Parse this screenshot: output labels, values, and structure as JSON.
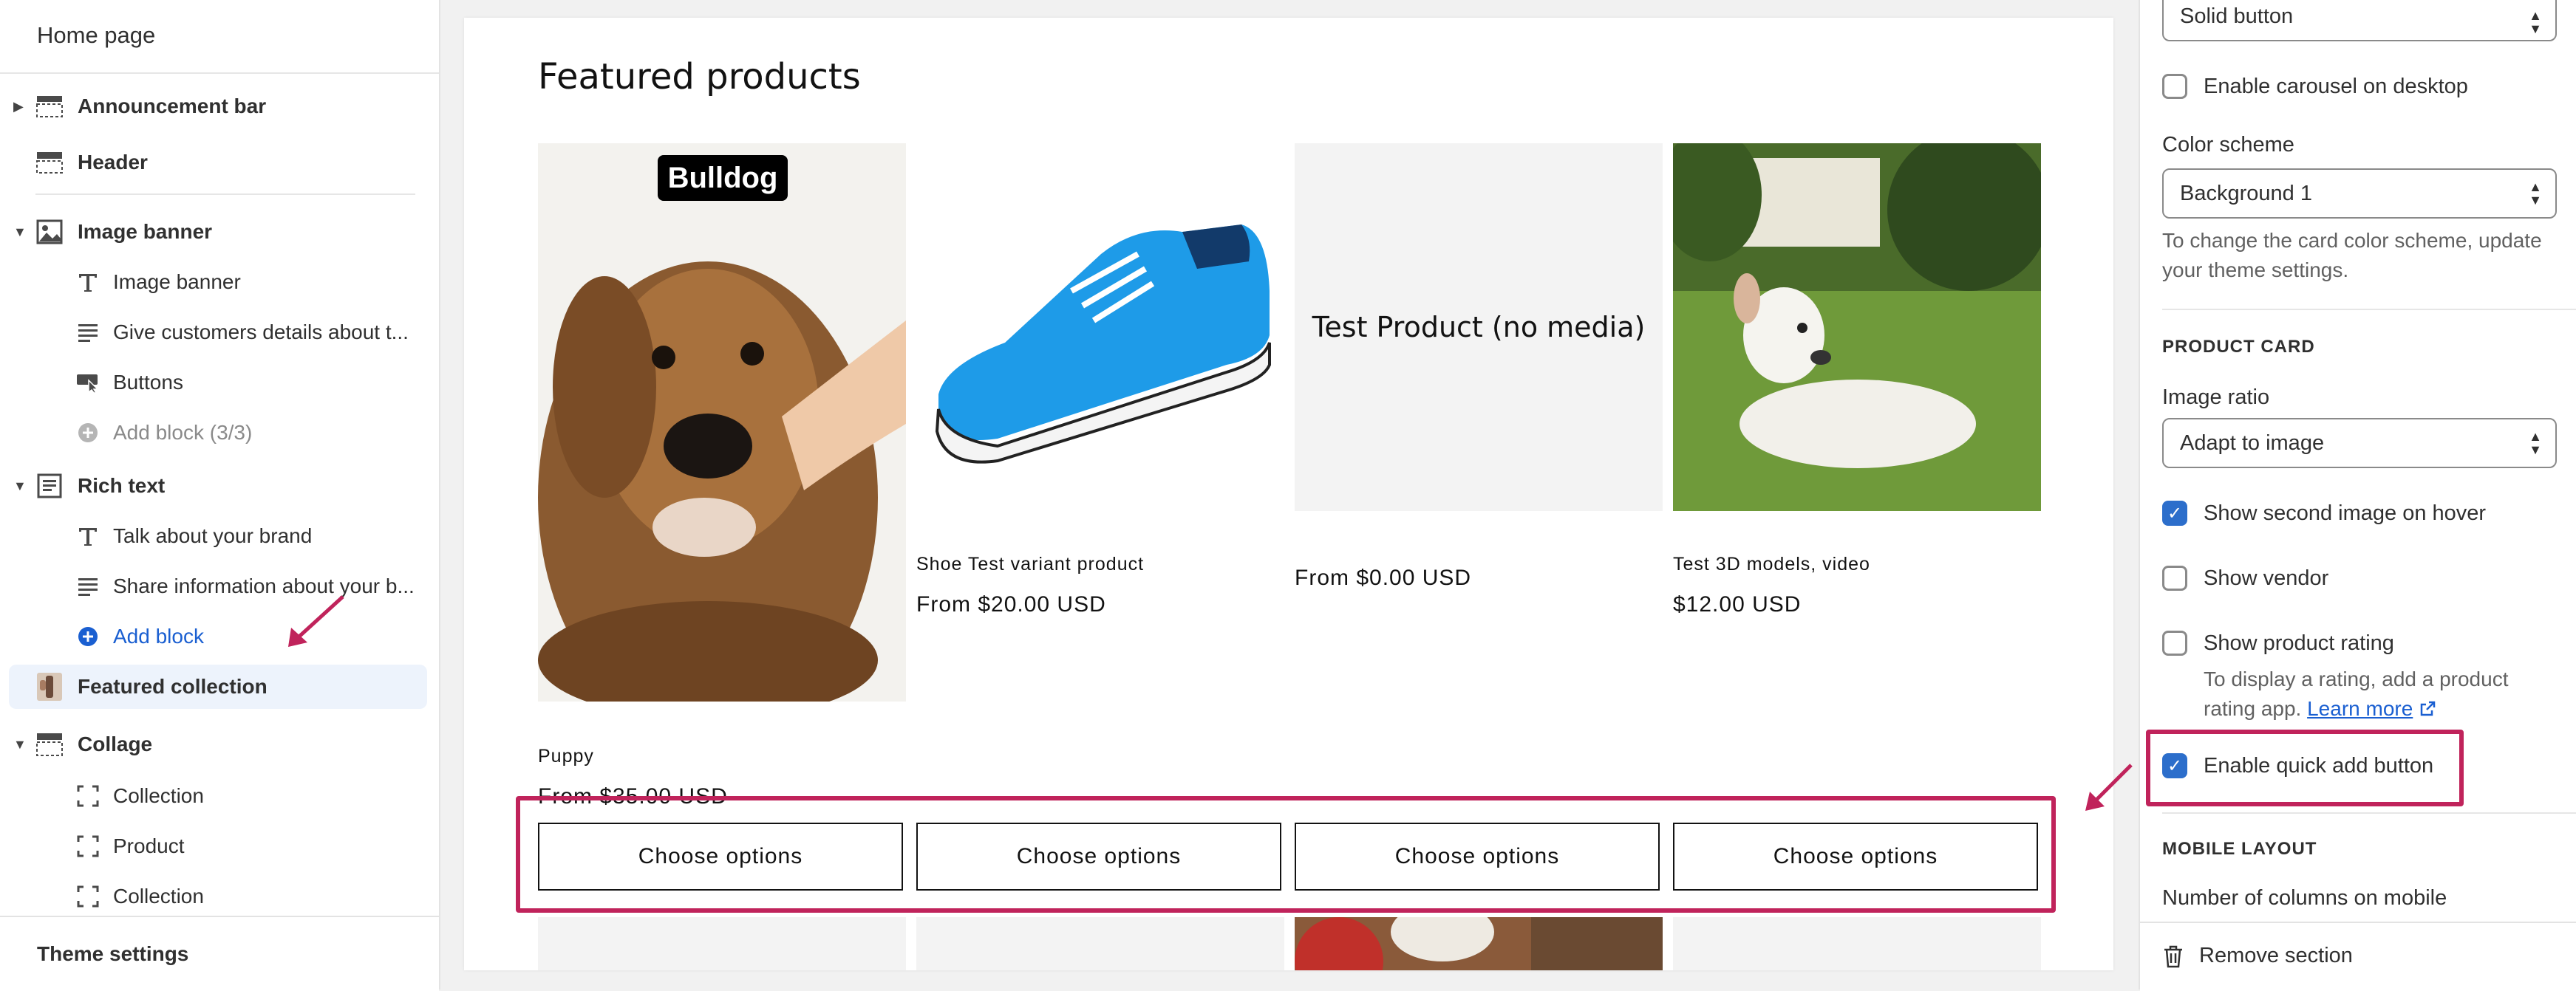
{
  "sidebar": {
    "title": "Home page",
    "items": [
      {
        "label": "Announcement bar",
        "icon": "section-icon",
        "level": "top",
        "caret": "right"
      },
      {
        "label": "Header",
        "icon": "header-icon",
        "level": "top",
        "caret": ""
      },
      {
        "label": "Image banner",
        "icon": "image-icon",
        "level": "top",
        "caret": "down"
      },
      {
        "label": "Image banner",
        "icon": "text-icon",
        "level": "sub"
      },
      {
        "label": "Give customers details about t...",
        "icon": "paragraph-icon",
        "level": "sub"
      },
      {
        "label": "Buttons",
        "icon": "buttons-icon",
        "level": "sub"
      },
      {
        "label": "Add block (3/3)",
        "icon": "add-circle-icon",
        "level": "sub"
      },
      {
        "label": "Rich text",
        "icon": "rich-text-icon",
        "level": "top",
        "caret": "down"
      },
      {
        "label": "Talk about your brand",
        "icon": "text-icon",
        "level": "sub"
      },
      {
        "label": "Share information about your b...",
        "icon": "paragraph-icon",
        "level": "sub"
      },
      {
        "label": "Add block",
        "icon": "add-circle-icon",
        "level": "sub"
      },
      {
        "label": "Featured collection",
        "icon": "collection-thumbnail-icon",
        "level": "top",
        "caret": ""
      },
      {
        "label": "Collage",
        "icon": "collage-icon",
        "level": "top",
        "caret": "down"
      },
      {
        "label": "Collection",
        "icon": "dashed-square-icon",
        "level": "sub"
      },
      {
        "label": "Product",
        "icon": "dashed-square-icon",
        "level": "sub"
      },
      {
        "label": "Collection",
        "icon": "dashed-square-icon",
        "level": "sub"
      }
    ],
    "footer": "Theme settings"
  },
  "preview": {
    "section_title": "Featured products",
    "products": [
      {
        "name": "Puppy",
        "price": "From $35.00 USD",
        "image_text": "Bulldog",
        "button": "Choose options"
      },
      {
        "name": "Shoe Test variant product",
        "price": "From $20.00 USD",
        "image_text": "",
        "button": "Choose options"
      },
      {
        "name": "",
        "price": "From $0.00 USD",
        "image_text": "Test Product (no media)",
        "button": "Choose options"
      },
      {
        "name": "Test 3D models, video",
        "price": "$12.00 USD",
        "image_text": "",
        "button": "Choose options"
      }
    ]
  },
  "settings": {
    "button_style": "Solid button",
    "carousel_label": "Enable carousel on desktop",
    "carousel_checked": false,
    "color_scheme_label": "Color scheme",
    "color_scheme_value": "Background 1",
    "color_scheme_help": "To change the card color scheme, update your theme settings.",
    "product_card_header": "PRODUCT CARD",
    "image_ratio_label": "Image ratio",
    "image_ratio_value": "Adapt to image",
    "second_image_label": "Show second image on hover",
    "second_image_checked": true,
    "vendor_label": "Show vendor",
    "vendor_checked": false,
    "rating_label": "Show product rating",
    "rating_checked": false,
    "rating_help": "To display a rating, add a product rating app.",
    "learn_more": "Learn more",
    "quick_add_label": "Enable quick add button",
    "quick_add_checked": true,
    "mobile_header": "MOBILE LAYOUT",
    "mobile_columns_label": "Number of columns on mobile",
    "remove_section": "Remove section"
  },
  "colors": {
    "highlight": "#c0235b",
    "accent": "#2c6ecb",
    "link": "#1a5fd1"
  }
}
